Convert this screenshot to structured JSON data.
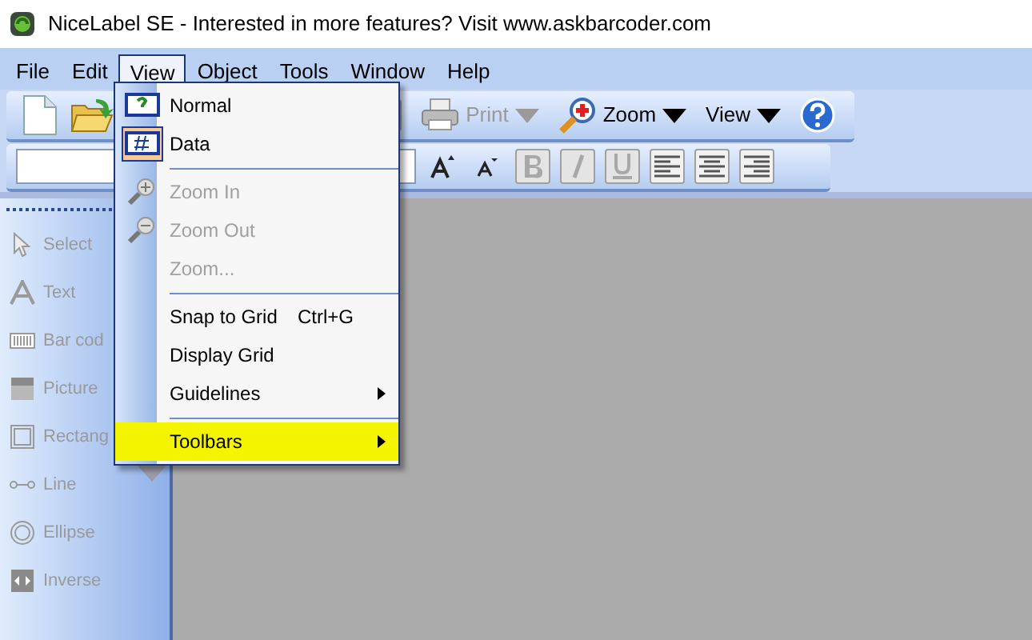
{
  "window": {
    "title": "NiceLabel SE - Interested in more features? Visit www.askbarcoder.com"
  },
  "menubar": [
    {
      "label": "File",
      "selected": false
    },
    {
      "label": "Edit",
      "selected": false
    },
    {
      "label": "View",
      "selected": true
    },
    {
      "label": "Object",
      "selected": false
    },
    {
      "label": "Tools",
      "selected": false
    },
    {
      "label": "Window",
      "selected": false
    },
    {
      "label": "Help",
      "selected": false
    }
  ],
  "toolbar": [
    {
      "kind": "new"
    },
    {
      "kind": "open"
    },
    {
      "kind": "export"
    },
    {
      "kind": "print",
      "label": "Print",
      "disabled": true
    },
    {
      "kind": "zoom",
      "label": "Zoom",
      "disabled": false
    },
    {
      "kind": "view",
      "label": "View",
      "disabled": false
    },
    {
      "kind": "help"
    }
  ],
  "format_toolbar": {
    "buttons": [
      {
        "kind": "grow"
      },
      {
        "kind": "shrink"
      },
      {
        "kind": "bold",
        "disabled": true
      },
      {
        "kind": "italic",
        "disabled": true
      },
      {
        "kind": "underline",
        "disabled": true
      },
      {
        "kind": "align-left",
        "disabled": false
      },
      {
        "kind": "align-center",
        "disabled": false
      },
      {
        "kind": "align-right",
        "disabled": false
      }
    ]
  },
  "tools": [
    {
      "label": "Select",
      "kind": "select",
      "disabled": true
    },
    {
      "label": "Text",
      "kind": "text",
      "disabled": true
    },
    {
      "label": "Bar cod",
      "kind": "barcode",
      "disabled": true
    },
    {
      "label": "Picture",
      "kind": "picture",
      "disabled": true
    },
    {
      "label": "Rectang",
      "kind": "rectangle",
      "disabled": true
    },
    {
      "label": "Line",
      "kind": "line",
      "disabled": true
    },
    {
      "label": "Ellipse",
      "kind": "ellipse",
      "disabled": true
    },
    {
      "label": "Inverse",
      "kind": "inverse",
      "disabled": true
    }
  ],
  "view_menu": [
    {
      "kind": "normal",
      "label": "Normal",
      "disabled": false,
      "checked": false,
      "submenu": false,
      "highlighted": false
    },
    {
      "kind": "data",
      "label": "Data",
      "disabled": false,
      "checked": true,
      "submenu": false,
      "highlighted": false
    },
    {
      "kind": "separator"
    },
    {
      "kind": "zoomin",
      "label": "Zoom In",
      "disabled": true,
      "submenu": false,
      "highlighted": false
    },
    {
      "kind": "zoomout",
      "label": "Zoom Out",
      "disabled": true,
      "submenu": false,
      "highlighted": false
    },
    {
      "kind": "item",
      "label": "Zoom...",
      "disabled": true,
      "submenu": false,
      "highlighted": false
    },
    {
      "kind": "separator"
    },
    {
      "kind": "item",
      "label": "Snap to Grid",
      "shortcut": "Ctrl+G",
      "disabled": false,
      "submenu": false,
      "highlighted": false
    },
    {
      "kind": "item",
      "label": "Display Grid",
      "disabled": false,
      "submenu": false,
      "highlighted": false
    },
    {
      "kind": "item",
      "label": "Guidelines",
      "disabled": false,
      "submenu": true,
      "highlighted": false
    },
    {
      "kind": "separator"
    },
    {
      "kind": "item",
      "label": "Toolbars",
      "disabled": false,
      "submenu": true,
      "highlighted": true
    }
  ]
}
